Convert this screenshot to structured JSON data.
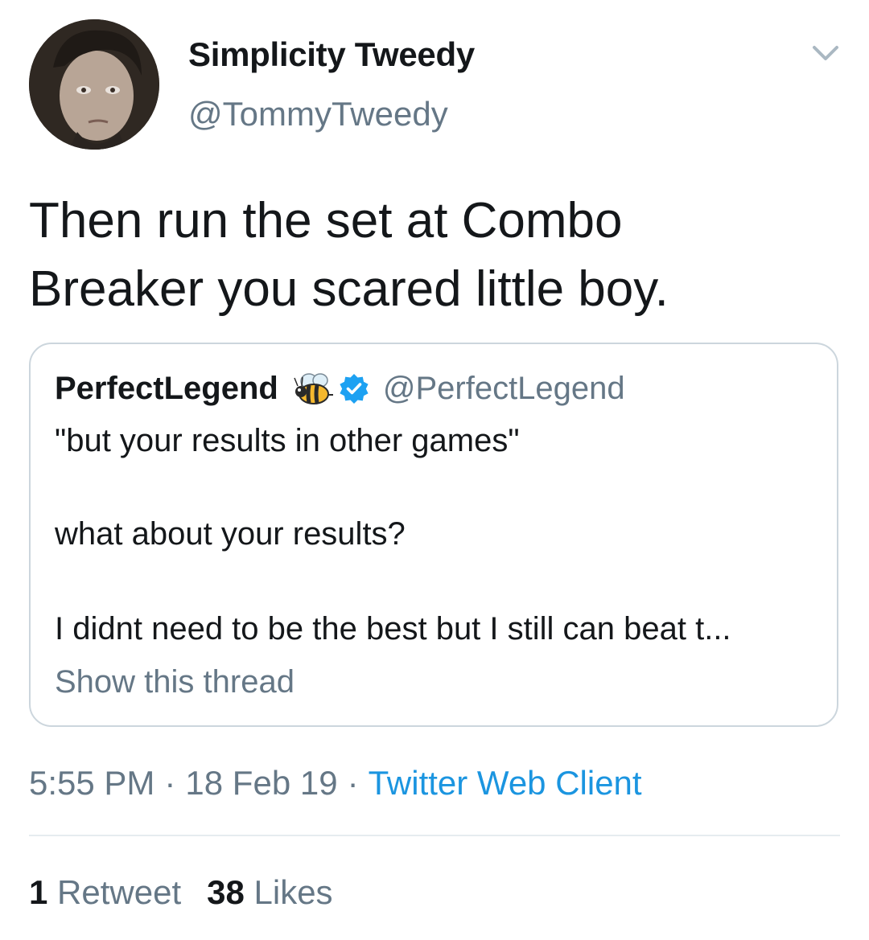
{
  "author": {
    "display_name": "Simplicity Tweedy",
    "handle": "@TommyTweedy"
  },
  "tweet": {
    "line1": "Then run the set at Combo",
    "line2": "Breaker you scared little boy."
  },
  "quoted_tweet": {
    "display_name": "PerfectLegend",
    "handle": "@PerfectLegend",
    "line1": "\"but your results in other games\"",
    "line2": "what about your results?",
    "line3": "I didnt need to be the best but I still can beat t...",
    "show_thread": "Show this thread"
  },
  "meta": {
    "time": "5:55 PM",
    "date": "18 Feb 19",
    "separator": "·",
    "client": "Twitter Web Client"
  },
  "stats": {
    "retweets_count": "1",
    "retweets_label": "Retweet",
    "likes_count": "38",
    "likes_label": "Likes"
  },
  "colors": {
    "primary_text": "#14171a",
    "secondary_text": "#657786",
    "link": "#1b95e0",
    "border": "#ccd6dd",
    "verified": "#1da1f2"
  },
  "icons": [
    "avatar-photo",
    "chevron-down-icon",
    "bee-emoji-icon",
    "verified-badge-icon"
  ]
}
